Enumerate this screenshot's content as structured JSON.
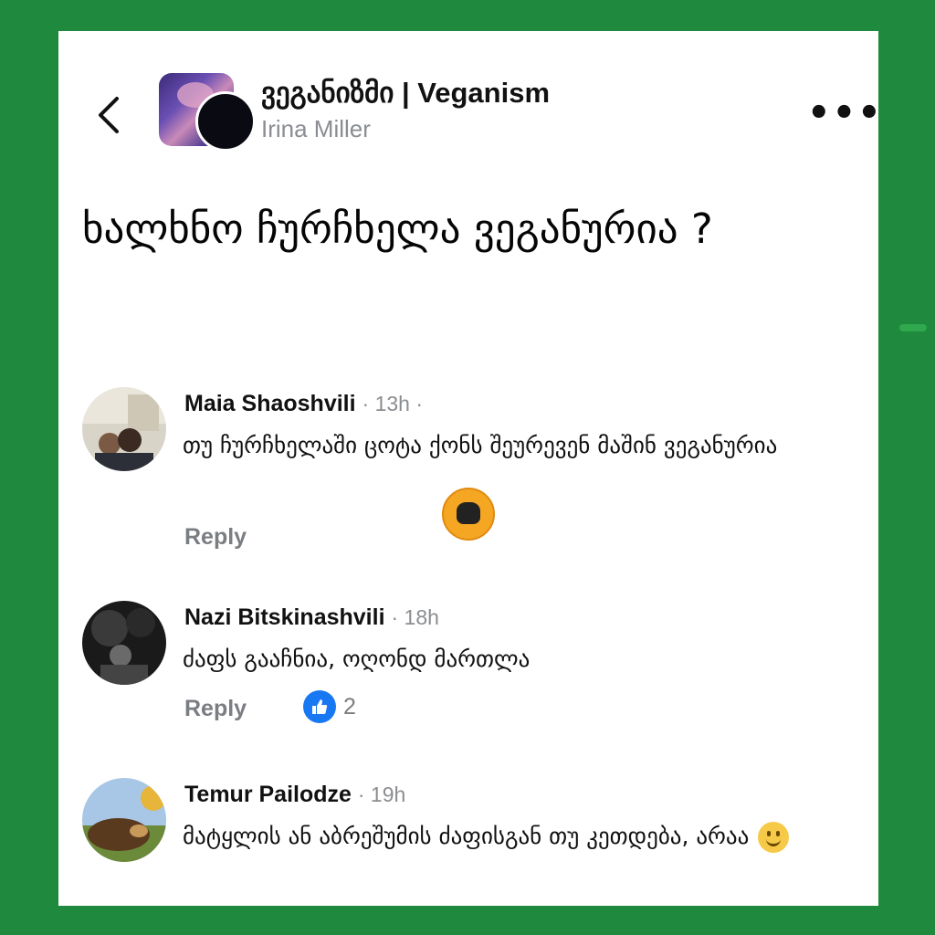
{
  "header": {
    "group_name": "ვეგანიზმი | Veganism",
    "author": "Irina Miller",
    "back_icon": "chevron-left-icon",
    "more_icon": "more-horizontal-icon",
    "more_label": "•••"
  },
  "post": {
    "title": "ხალხნო ჩურჩხელა ვეგანურია ?"
  },
  "comments": [
    {
      "name": "Maia Shaoshvili",
      "time": "· 13h ·",
      "text": "თუ ჩურჩხელაში ცოტა ქონს შეურევენ მაშინ ვეგანურია",
      "reply": "Reply"
    },
    {
      "name": "Nazi Bitskinashvili",
      "time": "· 18h",
      "text": "ძაფს გააჩნია, ოღონდ მართლა",
      "reply": "Reply",
      "likes": "2"
    },
    {
      "name": "Temur Pailodze",
      "time": "· 19h",
      "text": "მატყლის ან აბრეშუმის ძაფისგან თუ კეთდება, არაა"
    }
  ],
  "colors": {
    "frame_green": "#1f8a3d",
    "like_blue": "#1877f2",
    "meta_gray": "#8a8d91"
  }
}
